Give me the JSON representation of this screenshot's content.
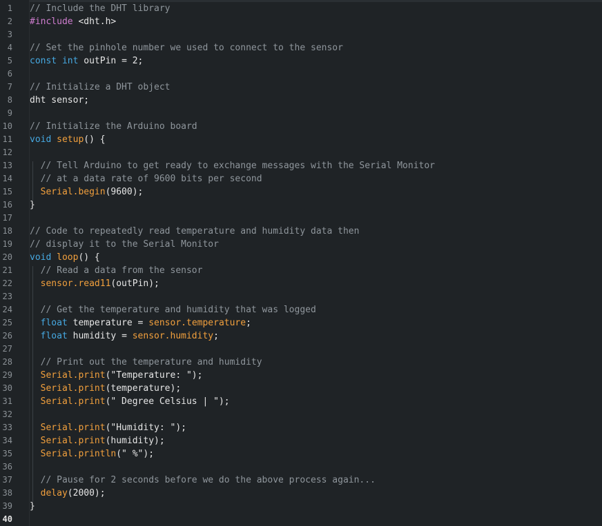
{
  "editor": {
    "lines": [
      [
        [
          "comment",
          "// Include the DHT library"
        ]
      ],
      [
        [
          "pre",
          "#include "
        ],
        [
          "plain",
          "<dht.h>"
        ]
      ],
      [],
      [
        [
          "comment",
          "// Set the pinhole number we used to connect to the sensor"
        ]
      ],
      [
        [
          "kw",
          "const"
        ],
        [
          "plain",
          " "
        ],
        [
          "kw",
          "int"
        ],
        [
          "plain",
          " outPin = 2;"
        ]
      ],
      [],
      [
        [
          "comment",
          "// Initialize a DHT object"
        ]
      ],
      [
        [
          "plain",
          "dht sensor;"
        ]
      ],
      [],
      [
        [
          "comment",
          "// Initialize the Arduino board"
        ]
      ],
      [
        [
          "kw",
          "void"
        ],
        [
          "plain",
          " "
        ],
        [
          "fn",
          "setup"
        ],
        [
          "plain",
          "() {"
        ]
      ],
      [],
      [
        [
          "plain",
          "  "
        ],
        [
          "comment",
          "// Tell Arduino to get ready to exchange messages with the Serial Monitor"
        ]
      ],
      [
        [
          "plain",
          "  "
        ],
        [
          "comment",
          "// at a data rate of 9600 bits per second"
        ]
      ],
      [
        [
          "plain",
          "  "
        ],
        [
          "fn",
          "Serial.begin"
        ],
        [
          "plain",
          "(9600);"
        ]
      ],
      [
        [
          "plain",
          "}"
        ]
      ],
      [],
      [
        [
          "comment",
          "// Code to repeatedly read temperature and humidity data then"
        ]
      ],
      [
        [
          "comment",
          "// display it to the Serial Monitor"
        ]
      ],
      [
        [
          "kw",
          "void"
        ],
        [
          "plain",
          " "
        ],
        [
          "fn",
          "loop"
        ],
        [
          "plain",
          "() {"
        ]
      ],
      [
        [
          "plain",
          "  "
        ],
        [
          "comment",
          "// Read a data from the sensor"
        ]
      ],
      [
        [
          "plain",
          "  "
        ],
        [
          "fn",
          "sensor.read11"
        ],
        [
          "plain",
          "(outPin);"
        ]
      ],
      [],
      [
        [
          "plain",
          "  "
        ],
        [
          "comment",
          "// Get the temperature and humidity that was logged"
        ]
      ],
      [
        [
          "plain",
          "  "
        ],
        [
          "kw",
          "float"
        ],
        [
          "plain",
          " temperature = "
        ],
        [
          "fn",
          "sensor.temperature"
        ],
        [
          "plain",
          ";"
        ]
      ],
      [
        [
          "plain",
          "  "
        ],
        [
          "kw",
          "float"
        ],
        [
          "plain",
          " humidity = "
        ],
        [
          "fn",
          "sensor.humidity"
        ],
        [
          "plain",
          ";"
        ]
      ],
      [],
      [
        [
          "plain",
          "  "
        ],
        [
          "comment",
          "// Print out the temperature and humidity"
        ]
      ],
      [
        [
          "plain",
          "  "
        ],
        [
          "fn",
          "Serial.print"
        ],
        [
          "plain",
          "(\"Temperature: \");"
        ]
      ],
      [
        [
          "plain",
          "  "
        ],
        [
          "fn",
          "Serial.print"
        ],
        [
          "plain",
          "(temperature);"
        ]
      ],
      [
        [
          "plain",
          "  "
        ],
        [
          "fn",
          "Serial.print"
        ],
        [
          "plain",
          "(\" Degree Celsius | \");"
        ]
      ],
      [],
      [
        [
          "plain",
          "  "
        ],
        [
          "fn",
          "Serial.print"
        ],
        [
          "plain",
          "(\"Humidity: \");"
        ]
      ],
      [
        [
          "plain",
          "  "
        ],
        [
          "fn",
          "Serial.print"
        ],
        [
          "plain",
          "(humidity);"
        ]
      ],
      [
        [
          "plain",
          "  "
        ],
        [
          "fn",
          "Serial.println"
        ],
        [
          "plain",
          "(\" %\");"
        ]
      ],
      [],
      [
        [
          "plain",
          "  "
        ],
        [
          "comment",
          "// Pause for 2 seconds before we do the above process again..."
        ]
      ],
      [
        [
          "plain",
          "  "
        ],
        [
          "fn",
          "delay"
        ],
        [
          "plain",
          "(2000);"
        ]
      ],
      [
        [
          "plain",
          "}"
        ]
      ],
      []
    ],
    "current_line": 40
  }
}
